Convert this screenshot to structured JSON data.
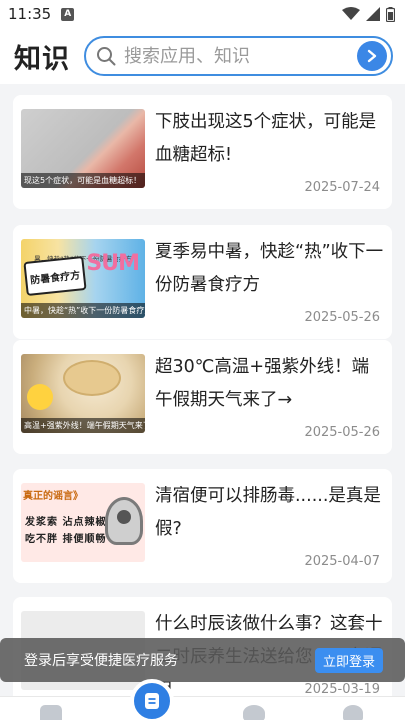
{
  "status": {
    "time": "11:35",
    "a_badge": "A"
  },
  "header": {
    "title": "知识",
    "search_placeholder": "搜索应用、知识"
  },
  "articles": [
    {
      "title": "下肢出现这5个症状，可能是血糖超标!",
      "date": "2025-07-24",
      "caption": "现这5个症状，可能是血糖超标！"
    },
    {
      "title": "夏季易中暑，快趁“热”收下一份防暑食疗方",
      "date": "2025-05-26",
      "caption": "中暑，快趁“热”收下一份防暑食疗方",
      "banner": "防暑食疗方",
      "banner_top": "暑，快趁“热”收下一份防暑食疗方",
      "sm": "SUM"
    },
    {
      "title": "超30℃高温+强紫外线！端午假期天气来了→",
      "date": "2025-05-26",
      "caption": "高温+强紫外线！端午假期天气来了→"
    },
    {
      "title": "清宿便可以排肠毒......是真是假?",
      "date": "2025-04-07",
      "l1": "真正的谣言》",
      "l2": "发浆索 沾点辣椒",
      "l3": "吃不胖 排便顺畅"
    },
    {
      "title": "什么时辰该做什么事？这套十二时辰养生法送给您，男女通用",
      "date": "2025-03-19"
    }
  ],
  "toast": {
    "text": "登录后享受便捷医疗服务",
    "button": "立即登录"
  },
  "colors": {
    "accent": "#3b87e6",
    "background": "#f3f4f6"
  }
}
